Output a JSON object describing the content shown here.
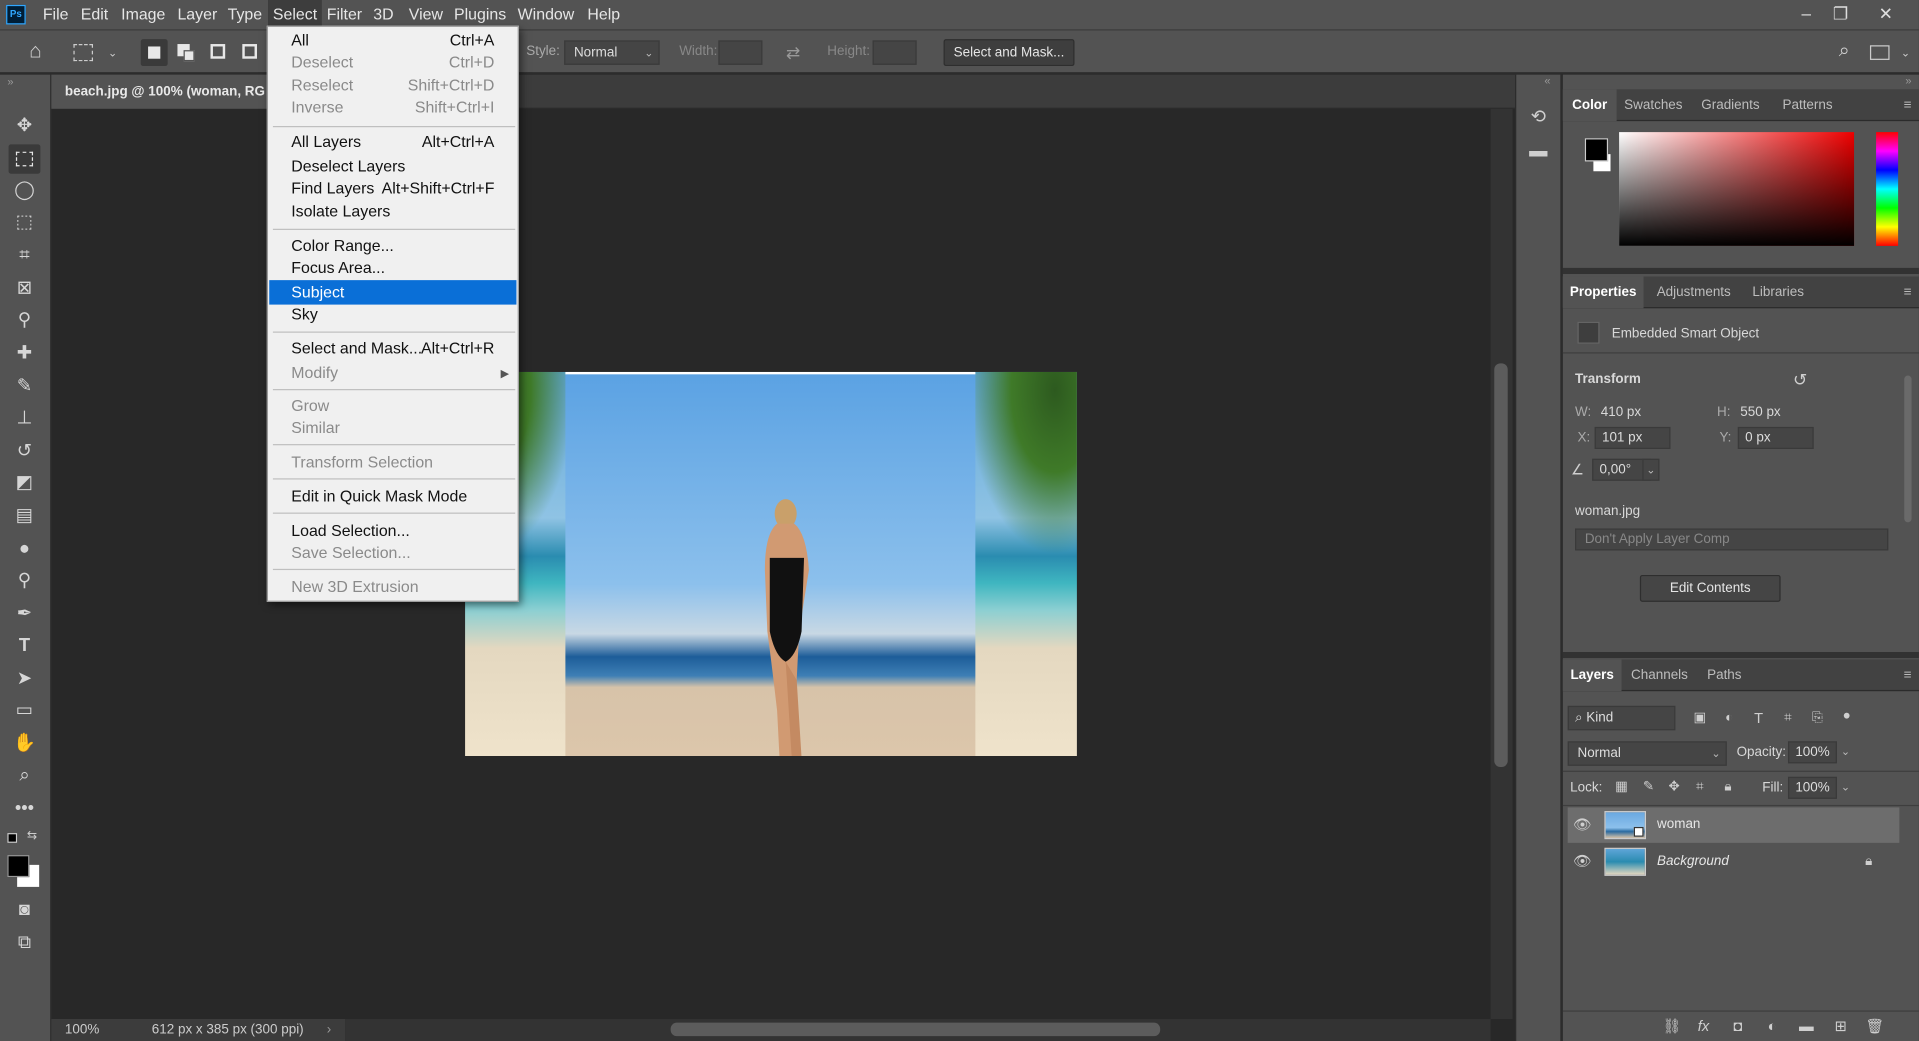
{
  "menubar": {
    "logo": "Ps",
    "items": [
      "File",
      "Edit",
      "Image",
      "Layer",
      "Type",
      "Select",
      "Filter",
      "3D",
      "View",
      "Plugins",
      "Window",
      "Help"
    ],
    "active_index": 5
  },
  "window_controls": {
    "minimize": "–",
    "restore": "❐",
    "close": "✕"
  },
  "options": {
    "style_label": "Style:",
    "style_value": "Normal",
    "width_label": "Width:",
    "height_label": "Height:",
    "select_mask_button": "Select and Mask..."
  },
  "document": {
    "tab_title": "beach.jpg @ 100% (woman, RG",
    "zoom": "100%",
    "info": "612 px x 385 px (300 ppi)"
  },
  "select_menu": [
    {
      "label": "All",
      "shortcut": "Ctrl+A",
      "disabled": false
    },
    {
      "label": "Deselect",
      "shortcut": "Ctrl+D",
      "disabled": true
    },
    {
      "label": "Reselect",
      "shortcut": "Shift+Ctrl+D",
      "disabled": true
    },
    {
      "label": "Inverse",
      "shortcut": "Shift+Ctrl+I",
      "disabled": true
    },
    {
      "label": "All Layers",
      "shortcut": "Alt+Ctrl+A",
      "disabled": false
    },
    {
      "label": "Deselect Layers",
      "shortcut": "",
      "disabled": false
    },
    {
      "label": "Find Layers",
      "shortcut": "Alt+Shift+Ctrl+F",
      "disabled": false
    },
    {
      "label": "Isolate Layers",
      "shortcut": "",
      "disabled": false
    },
    {
      "label": "Color Range...",
      "shortcut": "",
      "disabled": false
    },
    {
      "label": "Focus Area...",
      "shortcut": "",
      "disabled": false
    },
    {
      "label": "Subject",
      "shortcut": "",
      "disabled": false,
      "highlighted": true
    },
    {
      "label": "Sky",
      "shortcut": "",
      "disabled": false
    },
    {
      "label": "Select and Mask...",
      "shortcut": "Alt+Ctrl+R",
      "disabled": false
    },
    {
      "label": "Modify",
      "shortcut": "",
      "disabled": true,
      "submenu": true
    },
    {
      "label": "Grow",
      "shortcut": "",
      "disabled": true
    },
    {
      "label": "Similar",
      "shortcut": "",
      "disabled": true
    },
    {
      "label": "Transform Selection",
      "shortcut": "",
      "disabled": true
    },
    {
      "label": "Edit in Quick Mask Mode",
      "shortcut": "",
      "disabled": false
    },
    {
      "label": "Load Selection...",
      "shortcut": "",
      "disabled": false
    },
    {
      "label": "Save Selection...",
      "shortcut": "",
      "disabled": true
    },
    {
      "label": "New 3D Extrusion",
      "shortcut": "",
      "disabled": true
    }
  ],
  "color_panel": {
    "tabs": [
      "Color",
      "Swatches",
      "Gradients",
      "Patterns"
    ],
    "foreground": "#000000",
    "background": "#ffffff"
  },
  "properties_panel": {
    "tabs": [
      "Properties",
      "Adjustments",
      "Libraries"
    ],
    "object_type": "Embedded Smart Object",
    "transform_label": "Transform",
    "w_label": "W:",
    "w_value": "410 px",
    "h_label": "H:",
    "h_value": "550 px",
    "x_label": "X:",
    "x_value": "101 px",
    "y_label": "Y:",
    "y_value": "0 px",
    "angle_value": "0,00°",
    "source_file": "woman.jpg",
    "layer_comp": "Don't Apply Layer Comp",
    "edit_button": "Edit Contents"
  },
  "layers_panel": {
    "tabs": [
      "Layers",
      "Channels",
      "Paths"
    ],
    "filter_kind": "Kind",
    "blend_mode": "Normal",
    "opacity_label": "Opacity:",
    "opacity_value": "100%",
    "lock_label": "Lock:",
    "fill_label": "Fill:",
    "fill_value": "100%",
    "layers": [
      {
        "name": "woman",
        "selected": true
      },
      {
        "name": "Background",
        "selected": false,
        "locked": true
      }
    ]
  },
  "icons": {
    "home": "home-icon",
    "eye": "eye-icon",
    "lock": "lock-icon",
    "search": "search-icon"
  }
}
